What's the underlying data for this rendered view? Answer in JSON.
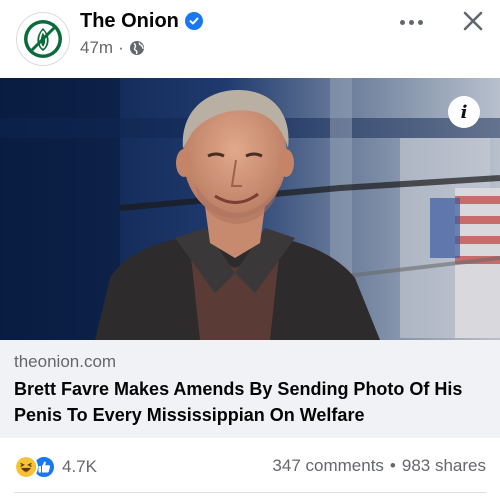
{
  "post": {
    "page_name": "The Onion",
    "timestamp": "47m",
    "separator": "·",
    "privacy_icon": "globe-icon",
    "verified": true
  },
  "header_actions": {
    "more_icon": "more-options-icon",
    "close_icon": "close-icon"
  },
  "media": {
    "info_label": "i"
  },
  "link_preview": {
    "domain": "theonion.com",
    "headline": "Brett Favre Makes Amends By Sending Photo Of His Penis To Every Mississippian On Welfare"
  },
  "engagement": {
    "reactions": [
      "laughing-emoji-icon",
      "like-icon"
    ],
    "reaction_count": "4.7K",
    "comments": "347 comments",
    "dot": "•",
    "shares": "983 shares"
  },
  "colors": {
    "brand_green": "#0a6b3a",
    "facebook_blue": "#1877f2",
    "secondary_text": "#65676b",
    "link_box_bg": "#f0f2f5"
  }
}
